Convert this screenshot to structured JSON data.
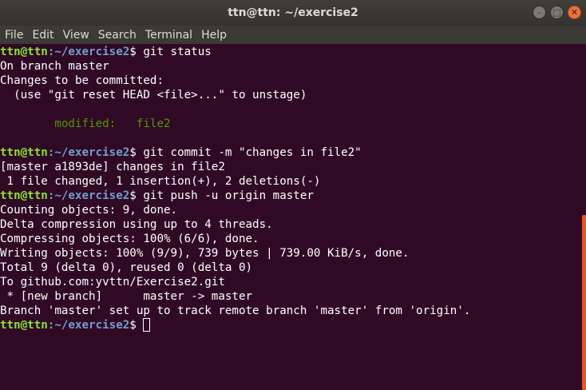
{
  "window": {
    "title": "ttn@ttn: ~/exercise2"
  },
  "menu": [
    "File",
    "Edit",
    "View",
    "Search",
    "Terminal",
    "Help"
  ],
  "prompt": {
    "user": "ttn@ttn",
    "path": ":~/exercise2",
    "symbol": "$ "
  },
  "lines": {
    "l1": "git status",
    "l2": "On branch master",
    "l3": "Changes to be committed:",
    "l4": "  (use \"git reset HEAD <file>...\" to unstage)",
    "l6": "        modified:   file2",
    "l8": "git commit -m \"changes in file2\"",
    "l9": "[master a1893de] changes in file2",
    "l10": " 1 file changed, 1 insertion(+), 2 deletions(-)",
    "l11": "git push -u origin master",
    "l12": "Counting objects: 9, done.",
    "l13": "Delta compression using up to 4 threads.",
    "l14": "Compressing objects: 100% (6/6), done.",
    "l15": "Writing objects: 100% (9/9), 739 bytes | 739.00 KiB/s, done.",
    "l16": "Total 9 (delta 0), reused 0 (delta 0)",
    "l17": "To github.com:yvttn/Exercise2.git",
    "l18": " * [new branch]      master -> master",
    "l19": "Branch 'master' set up to track remote branch 'master' from 'origin'."
  },
  "colors": {
    "background": "#300a24",
    "user": "#8ae234",
    "path": "#729fcf",
    "modified": "#4e9a06",
    "scrollbar": "#e95420"
  }
}
